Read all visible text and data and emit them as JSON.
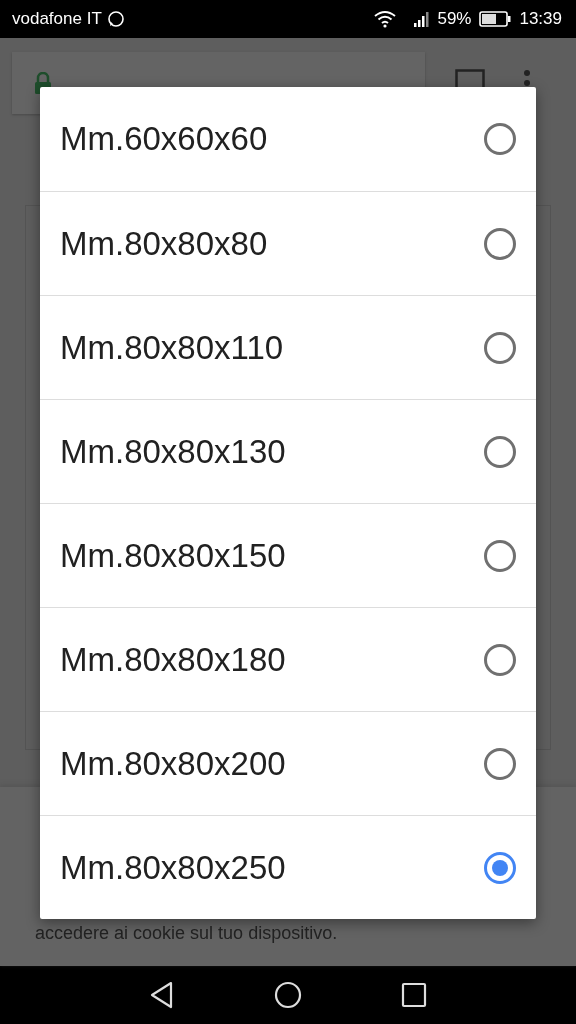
{
  "status_bar": {
    "carrier": "vodafone IT",
    "battery": "59%",
    "time": "13:39"
  },
  "cookie_banner": {
    "text": "accedere ai cookie sul tuo dispositivo."
  },
  "dialog": {
    "options": [
      {
        "label": "Mm.60x60x60",
        "selected": false
      },
      {
        "label": "Mm.80x80x80",
        "selected": false
      },
      {
        "label": "Mm.80x80x110",
        "selected": false
      },
      {
        "label": "Mm.80x80x130",
        "selected": false
      },
      {
        "label": "Mm.80x80x150",
        "selected": false
      },
      {
        "label": "Mm.80x80x180",
        "selected": false
      },
      {
        "label": "Mm.80x80x200",
        "selected": false
      },
      {
        "label": "Mm.80x80x250",
        "selected": true
      }
    ]
  }
}
